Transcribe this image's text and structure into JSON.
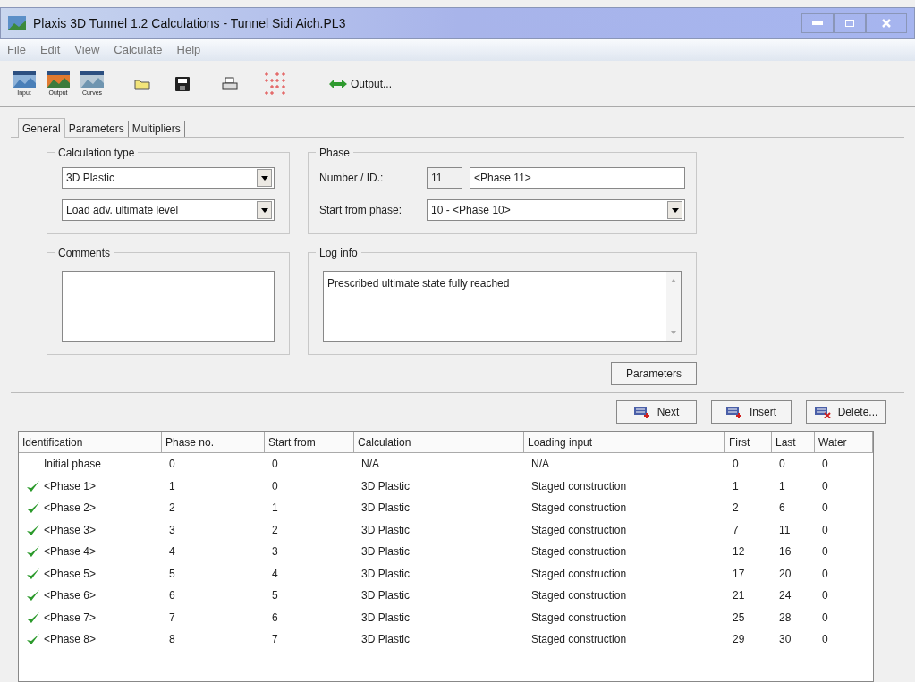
{
  "window": {
    "title": "Plaxis 3D Tunnel 1.2 Calculations - Tunnel Sidi Aich.PL3"
  },
  "menu": [
    "File",
    "Edit",
    "View",
    "Calculate",
    "Help"
  ],
  "toolbar": {
    "programs": [
      {
        "label": "Input"
      },
      {
        "label": "Output"
      },
      {
        "label": "Curves"
      }
    ],
    "output_button": "Output..."
  },
  "tabs": [
    {
      "label": "General",
      "selected": true
    },
    {
      "label": "Parameters",
      "selected": false
    },
    {
      "label": "Multipliers",
      "selected": false
    }
  ],
  "calculation_type": {
    "title": "Calculation type",
    "type": "3D Plastic",
    "loading": "Load adv. ultimate level"
  },
  "phase": {
    "title": "Phase",
    "number_label": "Number / ID.:",
    "number": "11",
    "id": "<Phase 11>",
    "start_label": "Start from phase:",
    "start": "10 - <Phase 10>"
  },
  "comments": {
    "title": "Comments"
  },
  "log_info": {
    "title": "Log info",
    "text": "Prescribed ultimate state fully reached"
  },
  "parameters_button": "Parameters",
  "actions": [
    "Next",
    "Insert",
    "Delete..."
  ],
  "table": {
    "columns": [
      "Identification",
      "Phase no.",
      "Start from",
      "Calculation",
      "Loading input",
      "First",
      "Last",
      "Water"
    ],
    "rows": [
      {
        "calculated": false,
        "cells": [
          "Initial phase",
          "0",
          "0",
          "N/A",
          "N/A",
          "0",
          "0",
          "0"
        ]
      },
      {
        "calculated": true,
        "cells": [
          "<Phase 1>",
          "1",
          "0",
          "3D Plastic",
          "Staged construction",
          "1",
          "1",
          "0"
        ]
      },
      {
        "calculated": true,
        "cells": [
          "<Phase 2>",
          "2",
          "1",
          "3D Plastic",
          "Staged construction",
          "2",
          "6",
          "0"
        ]
      },
      {
        "calculated": true,
        "cells": [
          "<Phase 3>",
          "3",
          "2",
          "3D Plastic",
          "Staged construction",
          "7",
          "11",
          "0"
        ]
      },
      {
        "calculated": true,
        "cells": [
          "<Phase 4>",
          "4",
          "3",
          "3D Plastic",
          "Staged construction",
          "12",
          "16",
          "0"
        ]
      },
      {
        "calculated": true,
        "cells": [
          "<Phase 5>",
          "5",
          "4",
          "3D Plastic",
          "Staged construction",
          "17",
          "20",
          "0"
        ]
      },
      {
        "calculated": true,
        "cells": [
          "<Phase 6>",
          "6",
          "5",
          "3D Plastic",
          "Staged construction",
          "21",
          "24",
          "0"
        ]
      },
      {
        "calculated": true,
        "cells": [
          "<Phase 7>",
          "7",
          "6",
          "3D Plastic",
          "Staged construction",
          "25",
          "28",
          "0"
        ]
      },
      {
        "calculated": true,
        "cells": [
          "<Phase 8>",
          "8",
          "7",
          "3D Plastic",
          "Staged construction",
          "29",
          "30",
          "0"
        ]
      }
    ]
  }
}
